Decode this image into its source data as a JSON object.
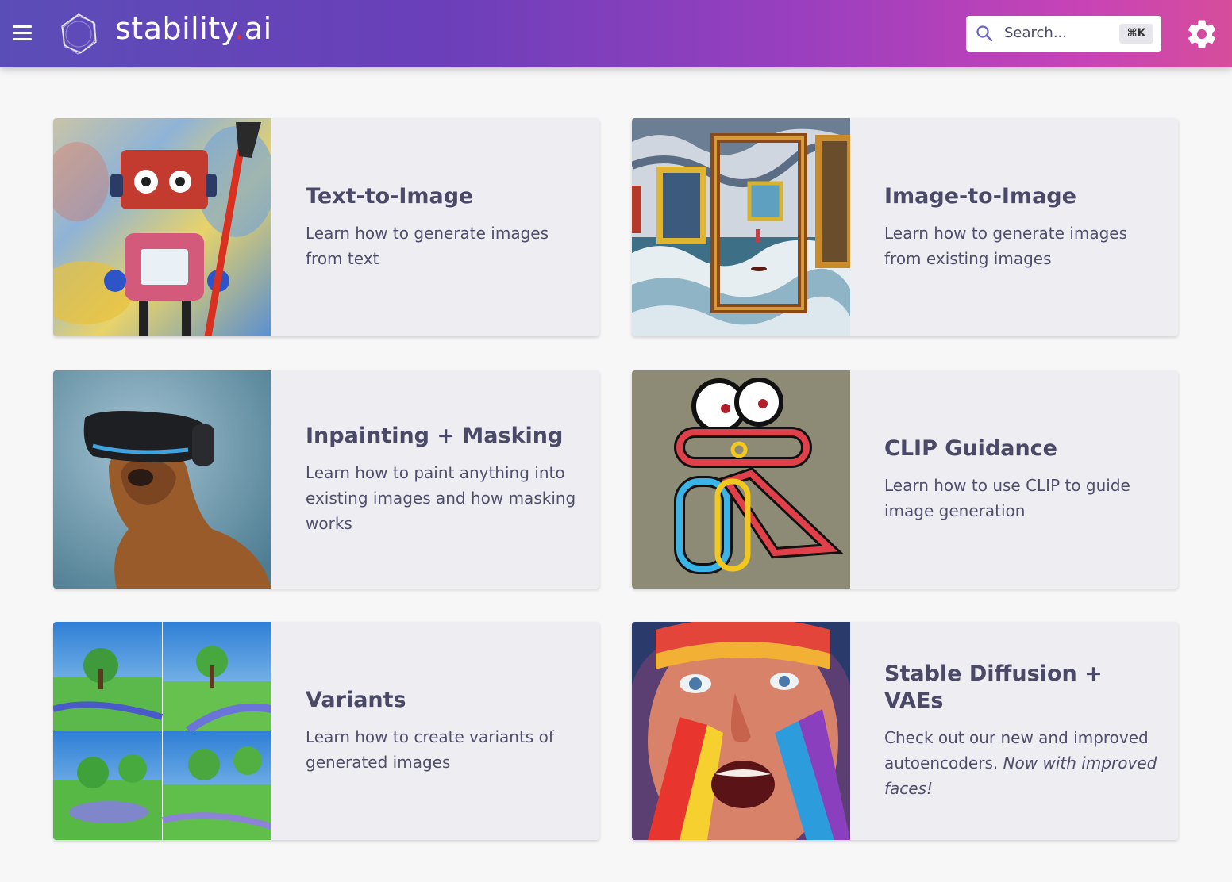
{
  "header": {
    "logo_text": "stability",
    "logo_dot": ".",
    "logo_suffix": "ai",
    "search": {
      "placeholder": "Search...",
      "shortcut": "⌘K"
    },
    "icons": [
      "menu-icon",
      "stability-logo-icon",
      "search-icon",
      "gear-icon"
    ]
  },
  "cards": [
    {
      "title": "Text-to-Image",
      "description": "Learn how to generate images from text"
    },
    {
      "title": "Image-to-Image",
      "description": "Learn how to generate images from existing images"
    },
    {
      "title": "Inpainting + Masking",
      "description": "Learn how to paint anything into existing images and how masking works"
    },
    {
      "title": "CLIP Guidance",
      "description": "Learn how to use CLIP to guide image generation"
    },
    {
      "title": "Variants",
      "description": "Learn how to create variants of generated images"
    },
    {
      "title": "Stable Diffusion + VAEs",
      "description": "Check out our new and improved autoencoders.",
      "description_emphasis": "Now with improved faces!"
    }
  ],
  "colors": {
    "header_start": "#5b4db8",
    "header_end": "#d64d9b",
    "card_bg": "#eeedf1",
    "title": "#4a4a68",
    "logo_dot": "#e62e2e"
  }
}
